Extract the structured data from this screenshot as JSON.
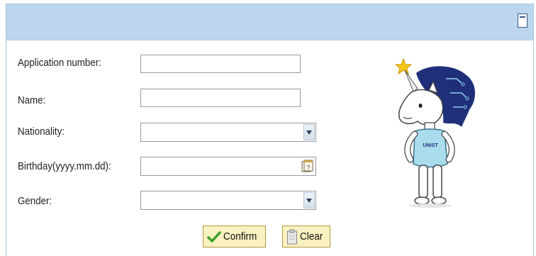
{
  "form": {
    "fields": {
      "application_number": {
        "label": "Application number:",
        "value": ""
      },
      "name": {
        "label": "Name:",
        "value": ""
      },
      "nationality": {
        "label": "Nationality:",
        "value": ""
      },
      "birthday": {
        "label": "Birthday(yyyy.mm.dd):",
        "value": ""
      },
      "gender": {
        "label": "Gender:",
        "value": ""
      }
    },
    "buttons": {
      "confirm": "Confirm",
      "clear": "Clear"
    }
  },
  "mascot": {
    "shirt_text": "UNIST"
  },
  "colors": {
    "header": "#bcd6ef",
    "border": "#aac6e2",
    "button": "#faf1c2",
    "mascot_hair": "#1f2f7a",
    "mascot_shirt": "#a9dcec",
    "star": "#f5c518"
  }
}
